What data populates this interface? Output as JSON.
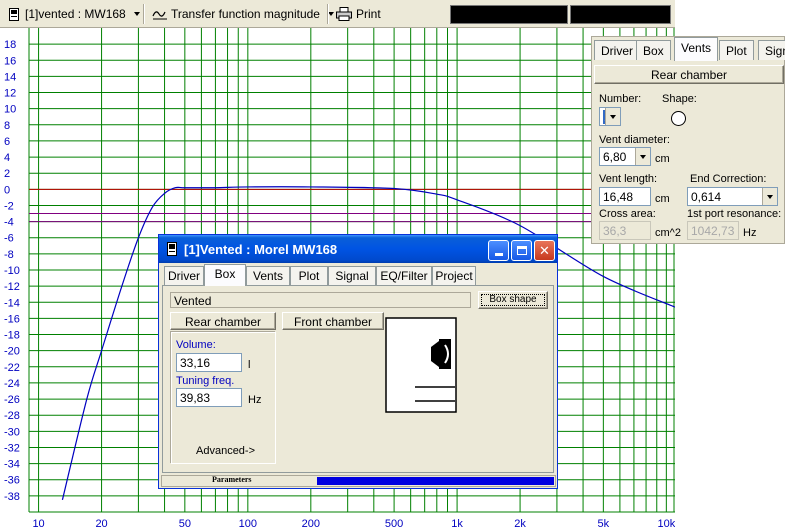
{
  "toolbar": {
    "view_select": "[1]vented : MW168",
    "plot_select": "Transfer function magnitude",
    "print_label": "Print"
  },
  "chart": {
    "y_ticks": [
      "18",
      "16",
      "14",
      "12",
      "10",
      "8",
      "6",
      "4",
      "2",
      "0",
      "-2",
      "-4",
      "-6",
      "-8",
      "-10",
      "-12",
      "-14",
      "-16",
      "-18",
      "-20",
      "-22",
      "-24",
      "-26",
      "-28",
      "-30",
      "-32",
      "-34",
      "-36",
      "-38"
    ],
    "x_ticks": [
      "10",
      "20",
      "50",
      "100",
      "200",
      "500",
      "1k",
      "2k",
      "5k",
      "10k"
    ],
    "colors": {
      "grid": "#008000",
      "curve": "#0000c0",
      "ref_red": "#c00000",
      "ref_purple": "#800080",
      "axis_text": "#0000c0"
    }
  },
  "chart_data": {
    "type": "line",
    "title": "",
    "xlabel": "",
    "ylabel": "",
    "x_scale": "log",
    "xlim": [
      9,
      11000
    ],
    "ylim": [
      -40,
      20
    ],
    "x_tick_labels": [
      "10",
      "20",
      "50",
      "100",
      "200",
      "500",
      "1k",
      "2k",
      "5k",
      "10k"
    ],
    "y_tick_labels": [
      18,
      16,
      14,
      12,
      10,
      8,
      6,
      4,
      2,
      0,
      -2,
      -4,
      -6,
      -8,
      -10,
      -12,
      -14,
      -16,
      -18,
      -20,
      -22,
      -24,
      -26,
      -28,
      -30,
      -32,
      -34,
      -36,
      -38
    ],
    "series": [
      {
        "x": [
          13,
          17,
          20,
          25,
          30,
          35,
          40,
          45,
          50,
          70,
          100,
          200,
          500,
          800,
          1000,
          2000,
          5000,
          11000
        ],
        "y": [
          -38.5,
          -26,
          -20,
          -12,
          -6,
          -2.2,
          -0.5,
          0.2,
          0.2,
          0.2,
          0.3,
          0.3,
          0.1,
          -0.6,
          -1.3,
          -4.5,
          -10.8,
          -14.6
        ]
      }
    ],
    "reference_lines": [
      0,
      -3,
      -4
    ],
    "grid": true
  },
  "panel": {
    "tabs": [
      "Driver",
      "Box",
      "Vents",
      "Plot",
      "Sign"
    ],
    "active_tab": "Vents",
    "section_button": "Rear chamber",
    "number_label": "Number:",
    "number_value": "1",
    "shape_label": "Shape:",
    "vent_diameter_label": "Vent diameter:",
    "vent_diameter_value": "6,80",
    "vent_diameter_unit": "cm",
    "vent_length_label": "Vent length:",
    "vent_length_value": "16,48",
    "vent_length_unit": "cm",
    "end_correction_label": "End Correction:",
    "end_correction_value": "0,614",
    "cross_area_label": "Cross area:",
    "cross_area_value": "36,3",
    "cross_area_unit": "cm^2",
    "port_resonance_label": "1st port resonance:",
    "port_resonance_value": "1042,73",
    "port_resonance_unit": "Hz"
  },
  "dialog": {
    "title": "[1]Vented : Morel MW168",
    "tabs": [
      "Driver",
      "Box",
      "Vents",
      "Plot",
      "Signal",
      "EQ/Filter",
      "Project"
    ],
    "active_tab": "Box",
    "box_type": "Vented",
    "box_shape_button": "Box shape",
    "rear_chamber_button": "Rear chamber",
    "front_chamber_button": "Front chamber",
    "volume_label": "Volume:",
    "volume_value": "33,16",
    "volume_unit": "l",
    "tuning_label": "Tuning freq.",
    "tuning_value": "39,83",
    "tuning_unit": "Hz",
    "advanced_label": "Advanced->",
    "status_label": "Parameters"
  }
}
